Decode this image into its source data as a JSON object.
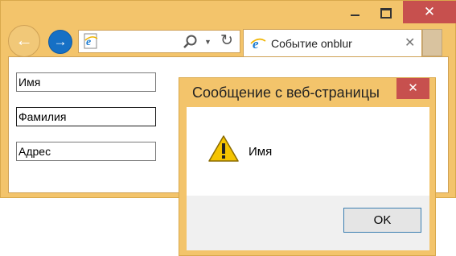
{
  "window": {
    "minimize_glyph": "",
    "close_glyph": "✕"
  },
  "toolbar": {
    "back_glyph": "←",
    "forward_glyph": "→",
    "refresh_glyph": "↻",
    "dropdown_glyph": "▼"
  },
  "tab": {
    "title": "Событие onblur",
    "close_glyph": "✕"
  },
  "form": {
    "fields": [
      {
        "value": "Имя"
      },
      {
        "value": "Фамилия"
      },
      {
        "value": "Адрес"
      }
    ]
  },
  "dialog": {
    "title": "Сообщение с веб-страницы",
    "message": "Имя",
    "ok_label": "OK",
    "close_glyph": "✕"
  },
  "colors": {
    "chrome_accent": "#f3c46b",
    "close_red": "#c7504e",
    "forward_blue": "#1670c5",
    "ok_border": "#3c7fb1"
  },
  "icons": [
    "ie-logo-icon",
    "search-icon",
    "chevron-down-icon",
    "refresh-icon",
    "warning-icon",
    "close-icon",
    "minimize-icon",
    "maximize-icon",
    "back-arrow-icon",
    "forward-arrow-icon"
  ]
}
